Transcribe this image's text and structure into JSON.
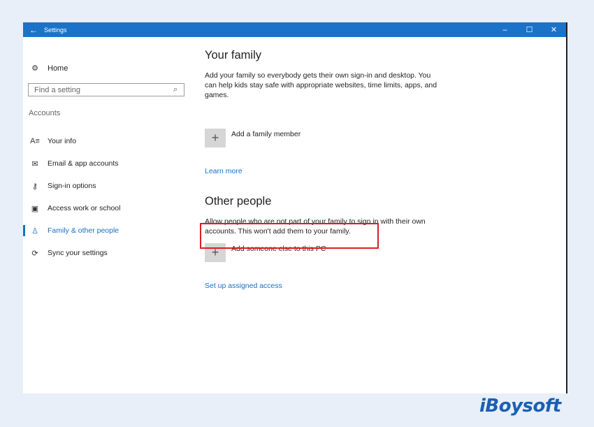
{
  "titlebar": {
    "back_icon": "←",
    "title": "Settings",
    "minimize": "–",
    "maximize": "☐",
    "close": "✕"
  },
  "sidebar": {
    "home_label": "Home",
    "search_placeholder": "Find a setting",
    "section_label": "Accounts",
    "items": [
      {
        "label": "Your info",
        "icon": "person-card-icon"
      },
      {
        "label": "Email & app accounts",
        "icon": "envelope-icon"
      },
      {
        "label": "Sign-in options",
        "icon": "key-icon"
      },
      {
        "label": "Access work or school",
        "icon": "briefcase-icon"
      },
      {
        "label": "Family & other people",
        "icon": "people-icon",
        "active": true
      },
      {
        "label": "Sync your settings",
        "icon": "sync-icon"
      }
    ]
  },
  "main": {
    "family": {
      "heading": "Your family",
      "description": "Add your family so everybody gets their own sign-in and desktop. You can help kids stay safe with appropriate websites, time limits, apps, and games.",
      "add_label": "Add a family member",
      "link": "Learn more"
    },
    "other": {
      "heading": "Other people",
      "description": "Allow people who are not part of your family to sign in with their own accounts. This won't add them to your family.",
      "add_label": "Add someone else to this PC",
      "link": "Set up assigned access"
    }
  },
  "watermark": "iBoysoft",
  "colors": {
    "accent": "#1a73c9",
    "highlight": "#d71f26",
    "background": "#e8eff8"
  }
}
